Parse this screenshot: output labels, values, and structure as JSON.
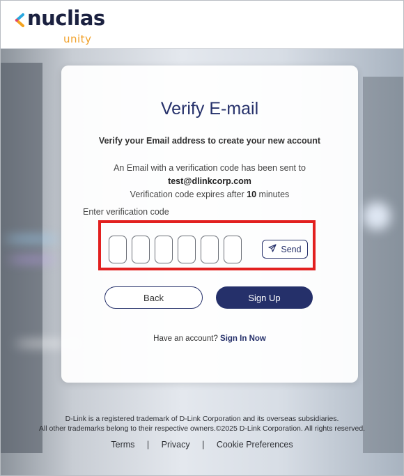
{
  "brand": {
    "logo_text": "nuclias",
    "logo_subtext": "unity"
  },
  "card": {
    "title": "Verify E-mail",
    "subtitle": "Verify your Email address to create your new account",
    "info_line1": "An Email with a verification code has been sent to",
    "email": "test@dlinkcorp.com",
    "expiry_prefix": "Verification code expires after",
    "expiry_value": "10",
    "expiry_suffix": "minutes",
    "code_label": "Enter verification code",
    "code_digits": [
      "",
      "",
      "",
      "",
      "",
      ""
    ],
    "send_label": "Send",
    "back_label": "Back",
    "signup_label": "Sign Up",
    "have_account_text": "Have an account?",
    "sign_in_label": "Sign In Now"
  },
  "footer": {
    "line1": "D-Link is a registered trademark of D-Link Corporation and its overseas subsidiaries.",
    "line2": "All other trademarks belong to their respective owners.©2025 D-Link Corporation. All rights reserved.",
    "links": [
      "Terms",
      "Privacy",
      "Cookie Preferences"
    ],
    "separator": "|"
  },
  "colors": {
    "brand_navy": "#25306a",
    "brand_orange": "#f1a12a",
    "highlight_red": "#e2201f"
  },
  "icons": {
    "send": "send-paper-plane-icon",
    "logo_mark": "nuclias-chevron-logo-icon"
  }
}
